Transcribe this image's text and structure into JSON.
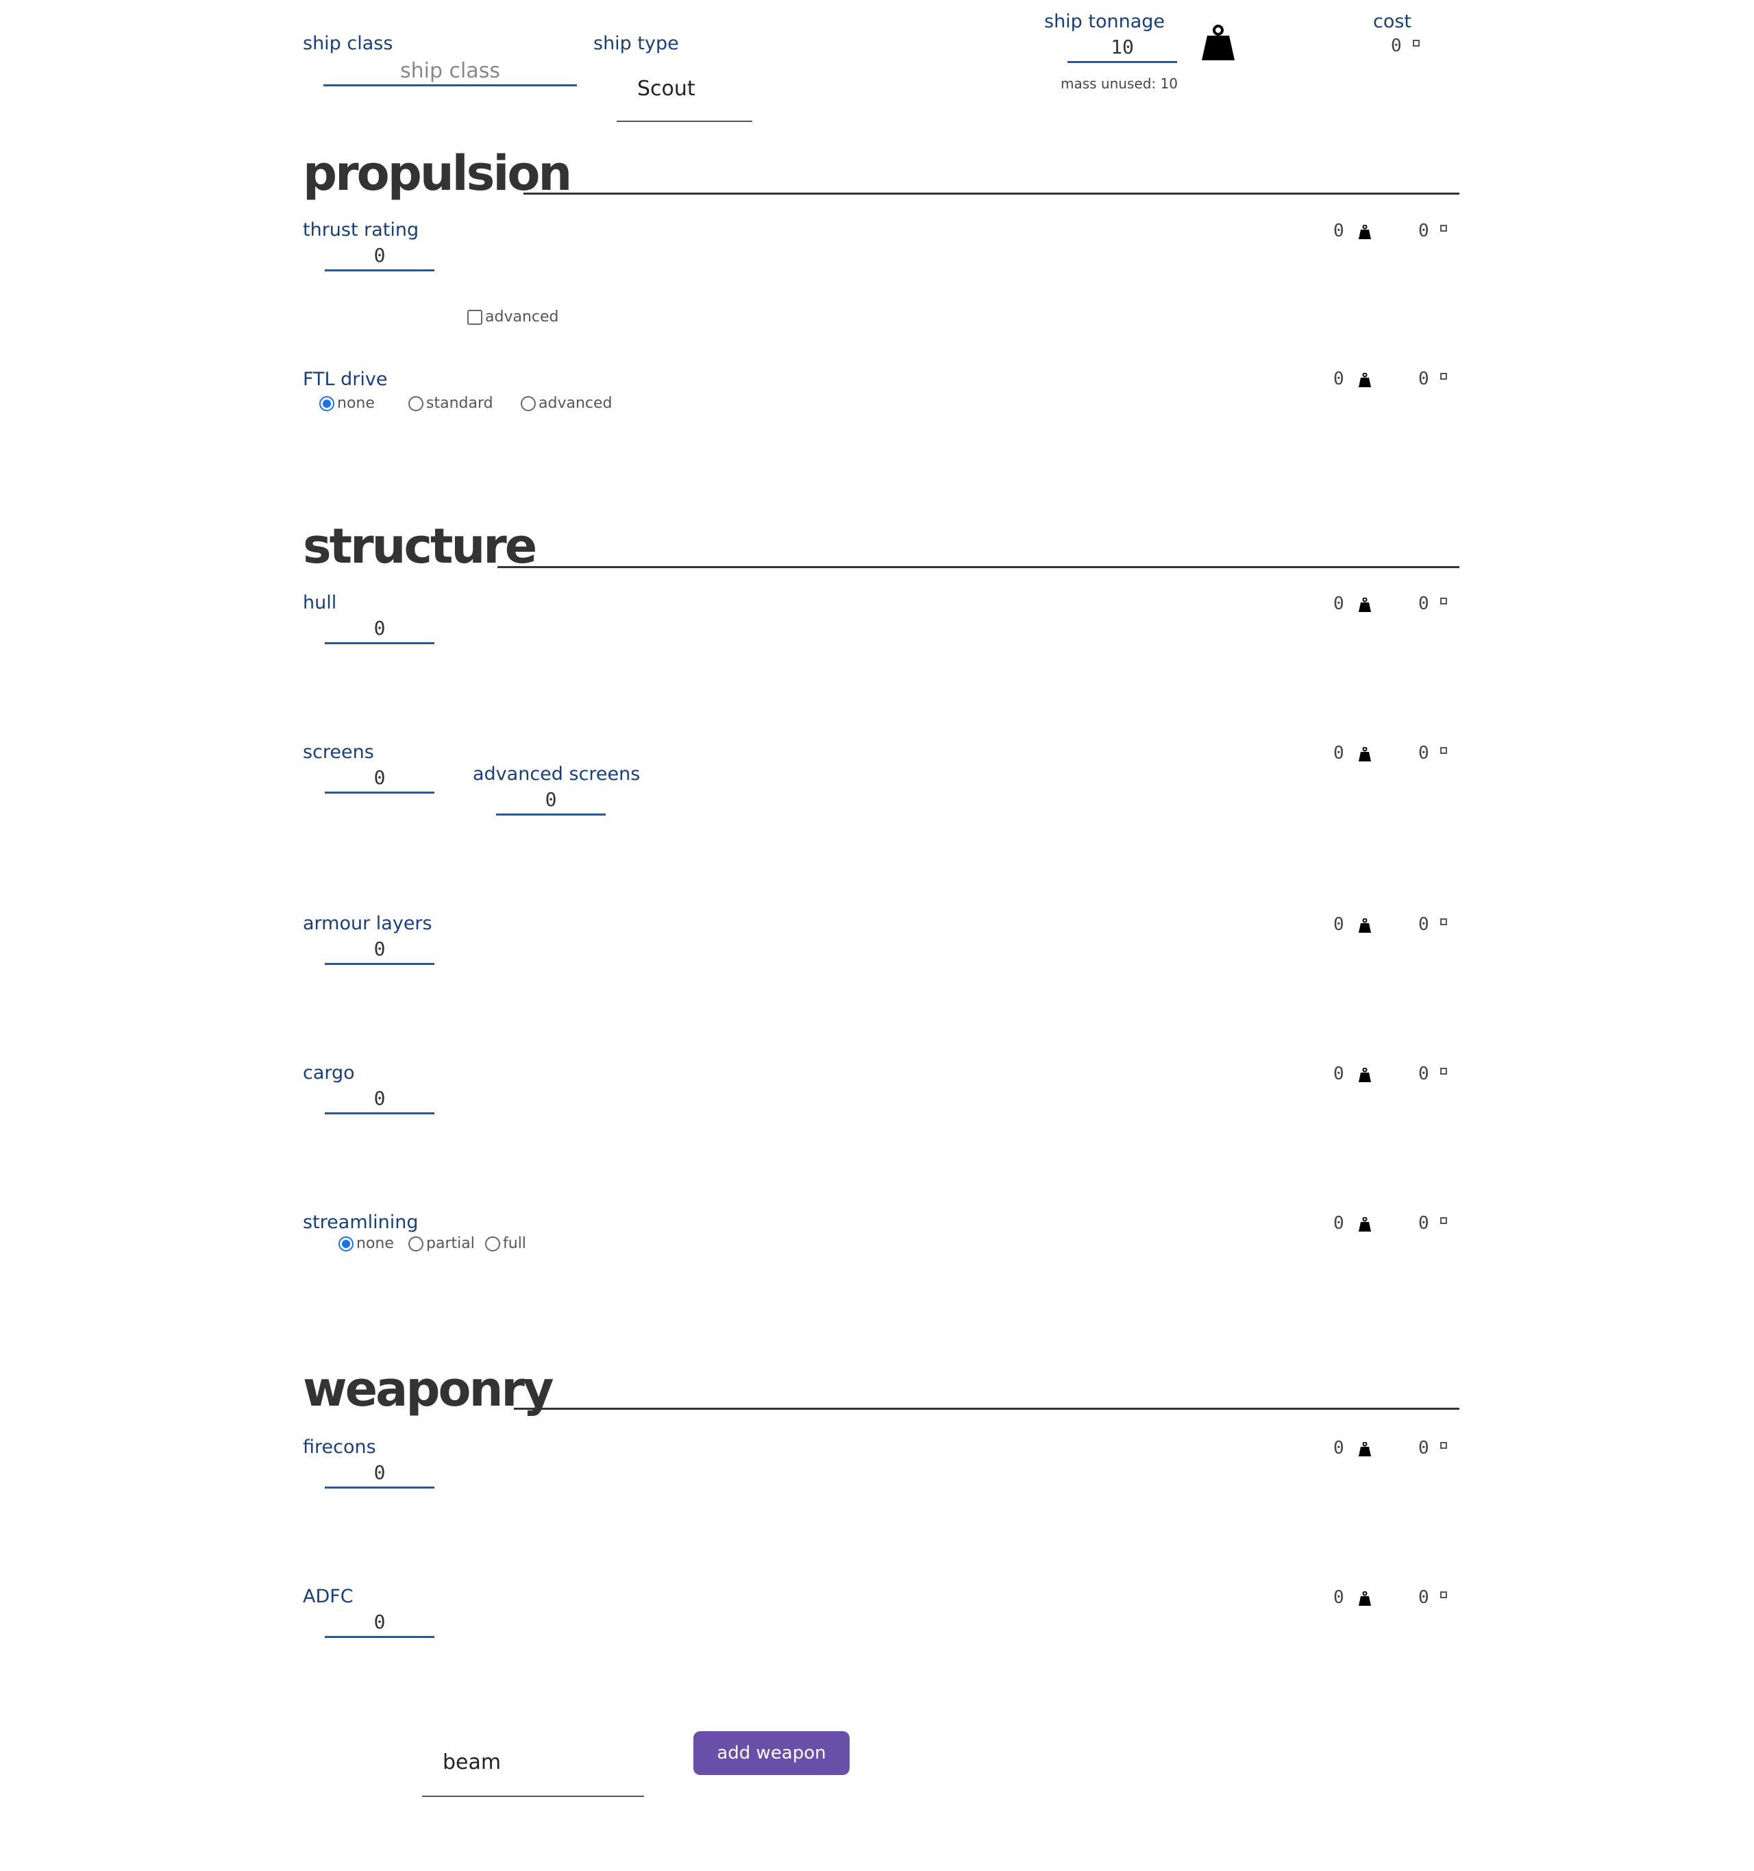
{
  "header": {
    "ship_class_label": "ship class",
    "ship_class_placeholder": "ship class",
    "ship_class_value": "",
    "ship_type_label": "ship type",
    "ship_type_value": "Scout",
    "tonnage_label": "ship tonnage",
    "tonnage_value": "10",
    "mass_unused": "mass unused: 10",
    "cost_label": "cost",
    "cost_value": "0"
  },
  "sections": {
    "propulsion": "propulsion",
    "structure": "structure",
    "weaponry": "weaponry"
  },
  "propulsion": {
    "thrust": {
      "label": "thrust rating",
      "value": "0",
      "mass": "0",
      "cost": "0",
      "advanced_label": "advanced",
      "advanced_checked": false
    },
    "ftl": {
      "label": "FTL drive",
      "options": [
        "none",
        "standard",
        "advanced"
      ],
      "selected": "none",
      "mass": "0",
      "cost": "0"
    }
  },
  "structure": {
    "hull": {
      "label": "hull",
      "value": "0",
      "mass": "0",
      "cost": "0"
    },
    "screens": {
      "label": "screens",
      "value": "0",
      "advanced_label": "advanced screens",
      "advanced_value": "0",
      "mass": "0",
      "cost": "0"
    },
    "armour": {
      "label": "armour layers",
      "value": "0",
      "mass": "0",
      "cost": "0"
    },
    "cargo": {
      "label": "cargo",
      "value": "0",
      "mass": "0",
      "cost": "0"
    },
    "streamlining": {
      "label": "streamlining",
      "options": [
        "none",
        "partial",
        "full"
      ],
      "selected": "none",
      "mass": "0",
      "cost": "0"
    }
  },
  "weaponry": {
    "firecons": {
      "label": "firecons",
      "value": "0",
      "mass": "0",
      "cost": "0"
    },
    "adfc": {
      "label": "ADFC",
      "value": "0",
      "mass": "0",
      "cost": "0"
    },
    "weapon_type_value": "beam",
    "add_weapon_label": "add weapon"
  },
  "icons": {
    "mass": "weight-icon",
    "cost": "coin-icon"
  }
}
